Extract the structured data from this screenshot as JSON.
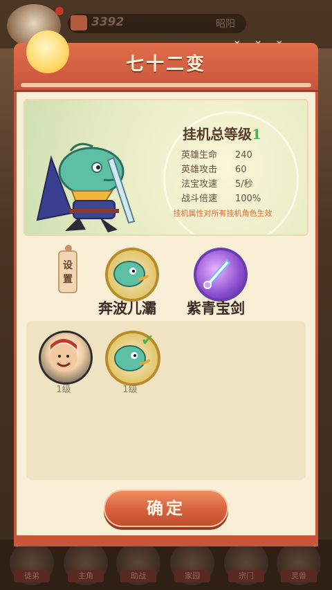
{
  "topbar": {
    "resource_value": "3392",
    "player_name": "昭阳"
  },
  "modal": {
    "title": "七十二变",
    "stats": {
      "heading": "挂机总等级",
      "level": "1",
      "rows": [
        {
          "label": "英雄生命",
          "value": "240"
        },
        {
          "label": "英雄攻击",
          "value": "60"
        },
        {
          "label": "法宝攻速",
          "value": "5/秒"
        },
        {
          "label": "战斗倍速",
          "value": "100%"
        }
      ],
      "note": "挂机属性对所有挂机角色生效"
    },
    "setting_label": "设置",
    "selected_role": "奔波儿灞",
    "selected_weapon": "紫青宝剑",
    "roster": [
      {
        "level": "1级"
      },
      {
        "level": "1级"
      }
    ],
    "confirm_label": "确定"
  },
  "bottom_nav": [
    "徒弟",
    "主角",
    "助战",
    "家园",
    "宗门",
    "灵兽"
  ]
}
